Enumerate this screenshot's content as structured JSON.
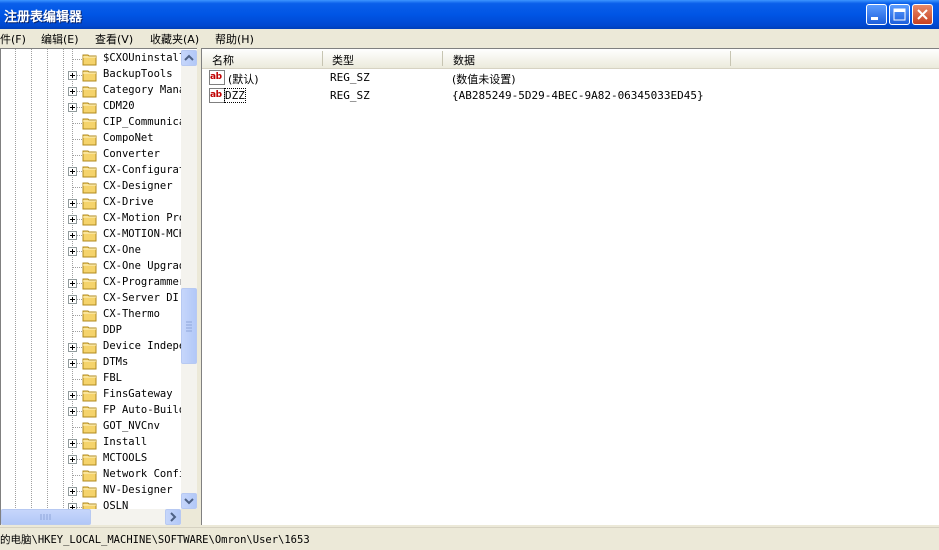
{
  "window": {
    "title": "注册表编辑器"
  },
  "menu": {
    "items": [
      "件(F)",
      "编辑(E)",
      "查看(V)",
      "收藏夹(A)",
      "帮助(H)"
    ]
  },
  "tree": {
    "items": [
      {
        "label": "$CXOUninstall",
        "expandable": false
      },
      {
        "label": "BackupTools",
        "expandable": true
      },
      {
        "label": "Category Mana",
        "expandable": true
      },
      {
        "label": "CDM20",
        "expandable": true
      },
      {
        "label": "CIP_Communica",
        "expandable": false
      },
      {
        "label": "CompoNet",
        "expandable": false
      },
      {
        "label": "Converter",
        "expandable": false
      },
      {
        "label": "CX-Configurat",
        "expandable": true
      },
      {
        "label": "CX-Designer",
        "expandable": false
      },
      {
        "label": "CX-Drive",
        "expandable": true
      },
      {
        "label": "CX-Motion Pro",
        "expandable": true
      },
      {
        "label": "CX-MOTION-MCH",
        "expandable": true
      },
      {
        "label": "CX-One",
        "expandable": true
      },
      {
        "label": "CX-One Upgrad",
        "expandable": false
      },
      {
        "label": "CX-Programmer",
        "expandable": true
      },
      {
        "label": "CX-Server DI",
        "expandable": true
      },
      {
        "label": "CX-Thermo",
        "expandable": false
      },
      {
        "label": "DDP",
        "expandable": false
      },
      {
        "label": "Device Indepe",
        "expandable": true
      },
      {
        "label": "DTMs",
        "expandable": true
      },
      {
        "label": "FBL",
        "expandable": false
      },
      {
        "label": "FinsGateway",
        "expandable": true
      },
      {
        "label": "FP Auto-Build",
        "expandable": true
      },
      {
        "label": "GOT_NVCnv",
        "expandable": false
      },
      {
        "label": "Install",
        "expandable": true
      },
      {
        "label": "MCTOOLS",
        "expandable": true
      },
      {
        "label": "Network Confi",
        "expandable": false
      },
      {
        "label": "NV-Designer",
        "expandable": true
      },
      {
        "label": "OSLN",
        "expandable": true
      }
    ]
  },
  "list": {
    "columns": [
      "名称",
      "类型",
      "数据"
    ],
    "rows": [
      {
        "name": "(默认)",
        "type": "REG_SZ",
        "data": "(数值未设置)",
        "icon": "string-value-icon"
      },
      {
        "name": "DZZ",
        "type": "REG_SZ",
        "data": "{AB285249-5D29-4BEC-9A82-06345033ED45}",
        "icon": "string-value-icon"
      }
    ]
  },
  "status": {
    "path": "的电脑\\HKEY_LOCAL_MACHINE\\SOFTWARE\\Omron\\User\\1653"
  },
  "colors": {
    "titlebar": "#0055e5",
    "close_button": "#c74121",
    "folder": "#f5d36b"
  }
}
